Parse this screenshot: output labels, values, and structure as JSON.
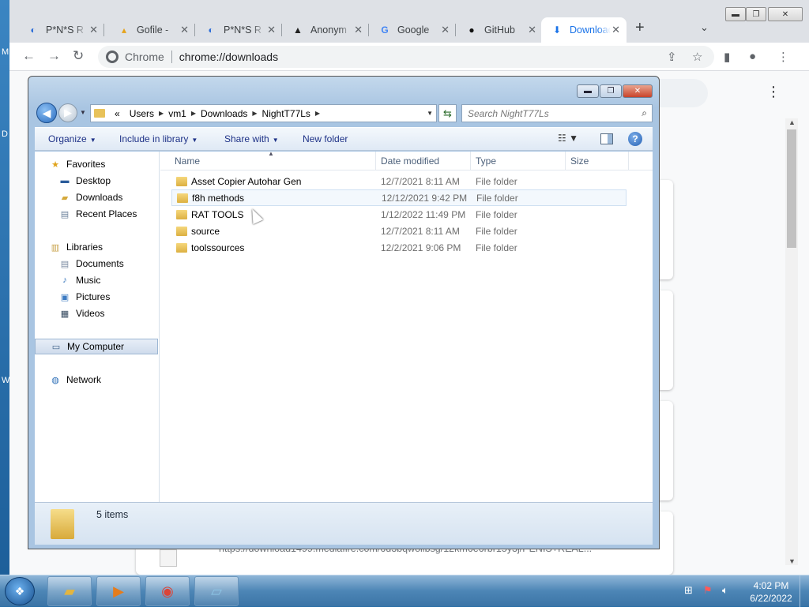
{
  "browser": {
    "tabs": [
      {
        "title": "P*N*S R",
        "icon": "edge-like-icon"
      },
      {
        "title": "Gofile - ",
        "icon": "gofile-icon"
      },
      {
        "title": "P*N*S R",
        "icon": "edge-like-icon"
      },
      {
        "title": "Anonym",
        "icon": "anonymous-icon"
      },
      {
        "title": "Google",
        "icon": "google-icon"
      },
      {
        "title": "GitHub",
        "icon": "github-icon"
      },
      {
        "title": "Download",
        "icon": "download-icon"
      }
    ],
    "omnibox_site": "Chrome",
    "omnibox_url": "chrome://downloads",
    "page_url_fragment": "https://download1499.mediafire.com/6u3bqwoilbsg/12km6e6rbr15y3j/PENIS+REAL..."
  },
  "explorer": {
    "path": [
      "Users",
      "vm1",
      "Downloads",
      "NightT77Ls"
    ],
    "path_prefix": "«",
    "search_placeholder": "Search NightT77Ls",
    "commands": {
      "organize": "Organize",
      "include": "Include in library",
      "share": "Share with",
      "new_folder": "New folder"
    },
    "nav": {
      "favorites": "Favorites",
      "desktop": "Desktop",
      "downloads": "Downloads",
      "recent": "Recent Places",
      "libraries": "Libraries",
      "documents": "Documents",
      "music": "Music",
      "pictures": "Pictures",
      "videos": "Videos",
      "computer": "My Computer",
      "network": "Network"
    },
    "columns": {
      "name": "Name",
      "date": "Date modified",
      "type": "Type",
      "size": "Size"
    },
    "files": [
      {
        "name": "Asset Copier Autohar Gen",
        "date": "12/7/2021 8:11 AM",
        "type": "File folder"
      },
      {
        "name": "f8h methods",
        "date": "12/12/2021 9:42 PM",
        "type": "File folder"
      },
      {
        "name": "RAT TOOLS",
        "date": "1/12/2022 11:49 PM",
        "type": "File folder"
      },
      {
        "name": "source",
        "date": "12/7/2021 8:11 AM",
        "type": "File folder"
      },
      {
        "name": "toolssources",
        "date": "12/2/2021 9:06 PM",
        "type": "File folder"
      }
    ],
    "item_count": "5 items"
  },
  "taskbar": {
    "time": "4:02 PM",
    "date": "6/22/2022"
  },
  "desktop_letters": [
    "M",
    "D",
    "W"
  ]
}
